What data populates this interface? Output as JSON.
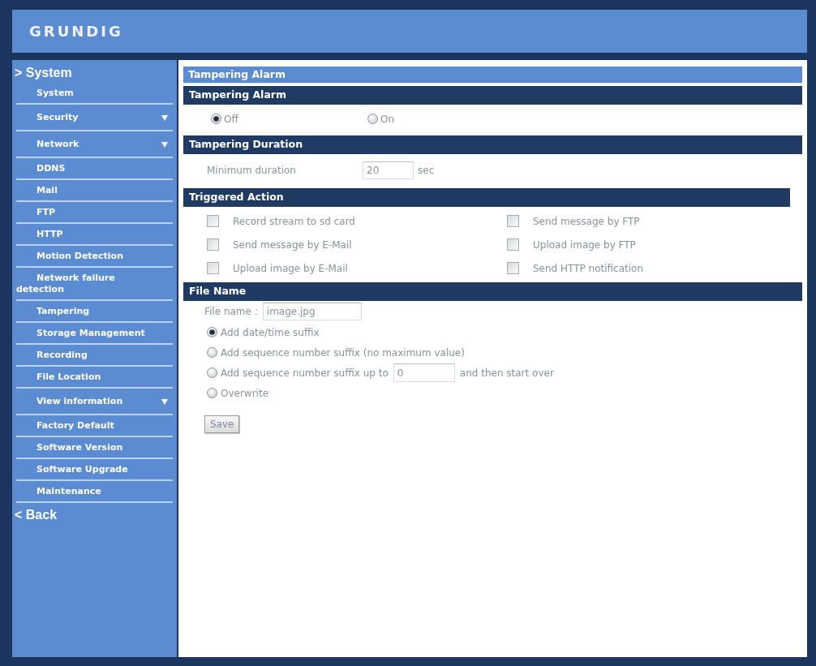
{
  "header": {
    "logo": "GRUNDIG"
  },
  "sidebar": {
    "heading": "> System",
    "items": [
      {
        "label": "System",
        "submenu": false
      },
      {
        "label": "Security",
        "submenu": true
      },
      {
        "label": "Network",
        "submenu": true
      },
      {
        "label": "DDNS",
        "submenu": false
      },
      {
        "label": "Mail",
        "submenu": false
      },
      {
        "label": "FTP",
        "submenu": false
      },
      {
        "label": "HTTP",
        "submenu": false
      },
      {
        "label": "Motion Detection",
        "submenu": false
      },
      {
        "label": "Network failure detection",
        "submenu": false
      },
      {
        "label": "Tampering",
        "submenu": false
      },
      {
        "label": "Storage Management",
        "submenu": false
      },
      {
        "label": "Recording",
        "submenu": false
      },
      {
        "label": "File Location",
        "submenu": false
      },
      {
        "label": "View information",
        "submenu": true
      },
      {
        "label": "Factory Default",
        "submenu": false
      },
      {
        "label": "Software Version",
        "submenu": false
      },
      {
        "label": "Software Upgrade",
        "submenu": false
      },
      {
        "label": "Maintenance",
        "submenu": false
      }
    ],
    "back": "< Back"
  },
  "page": {
    "title": "Tampering Alarm",
    "tampering_alarm": {
      "heading": "Tampering Alarm",
      "options": [
        {
          "label": "Off",
          "selected": true
        },
        {
          "label": "On",
          "selected": false
        }
      ]
    },
    "tampering_duration": {
      "heading": "Tampering Duration",
      "label": "Minimum duration",
      "value": "20",
      "unit": "sec"
    },
    "triggered_action": {
      "heading": "Triggered Action",
      "actions": [
        {
          "label": "Record stream to sd card",
          "checked": false
        },
        {
          "label": "Send message by FTP",
          "checked": false
        },
        {
          "label": "Send message by E-Mail",
          "checked": false
        },
        {
          "label": "Upload image by FTP",
          "checked": false
        },
        {
          "label": "Upload image by E-Mail",
          "checked": false
        },
        {
          "label": "Send HTTP notification",
          "checked": false
        }
      ]
    },
    "file_name": {
      "heading": "File Name",
      "label": "File name :",
      "value": "image.jpg",
      "options": [
        {
          "kind": "plain",
          "label": "Add date/time suffix",
          "selected": true
        },
        {
          "kind": "plain",
          "label": "Add sequence number suffix (no maximum value)",
          "selected": false
        },
        {
          "kind": "limit",
          "label": "Add sequence number suffix up to",
          "value": "0",
          "after": "and then start over",
          "selected": false
        },
        {
          "kind": "plain",
          "label": "Overwrite",
          "selected": false
        }
      ]
    },
    "save_button": "Save"
  }
}
